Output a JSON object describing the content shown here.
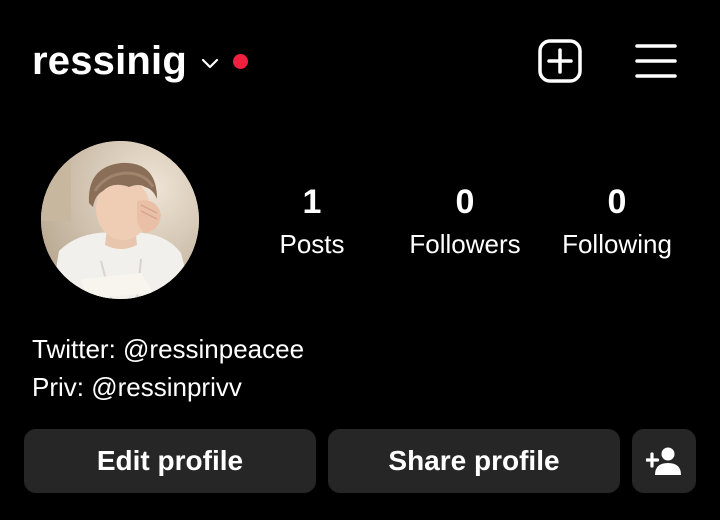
{
  "header": {
    "username": "ressinig",
    "icons": {
      "dropdown": "chevron-down-icon",
      "notification": "red-dot-indicator",
      "create": "plus-square-icon",
      "menu": "hamburger-menu-icon"
    }
  },
  "profile": {
    "avatar": "profile-photo",
    "stats": [
      {
        "value": "1",
        "label": "Posts"
      },
      {
        "value": "0",
        "label": "Followers"
      },
      {
        "value": "0",
        "label": "Following"
      }
    ],
    "bio": [
      "Twitter: @ressinpeacee",
      "Priv: @ressinprivv"
    ]
  },
  "actions": {
    "edit_label": "Edit profile",
    "share_label": "Share profile",
    "add_icon": "person-add-icon"
  },
  "colors": {
    "background": "#000000",
    "button_bg": "#262626",
    "notification_dot": "#f0213f",
    "text": "#ffffff"
  }
}
